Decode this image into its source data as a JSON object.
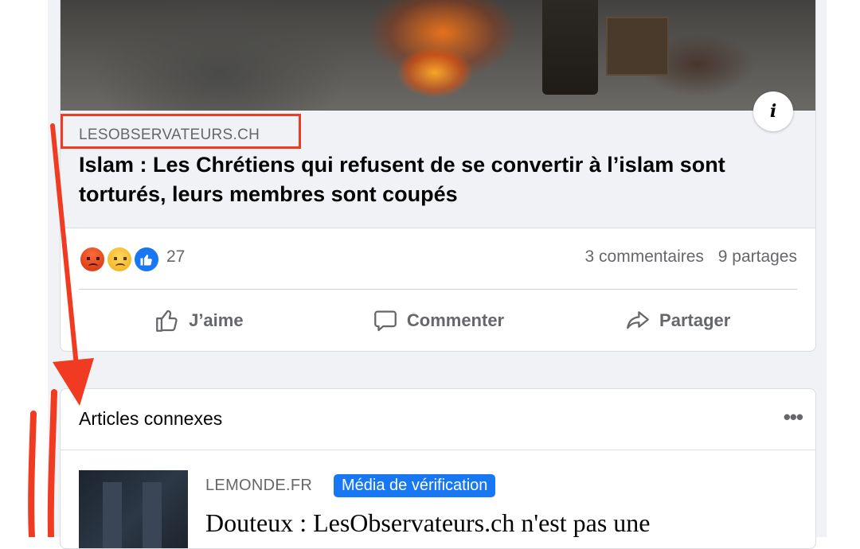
{
  "post": {
    "link_domain": "LESOBSERVATEURS.CH",
    "link_title": "Islam : Les Chrétiens qui refusent de se convertir à l’islam sont torturés, leurs membres sont coupés",
    "info_label": "i",
    "reaction_count": "27",
    "reactions": [
      "angry",
      "sad",
      "like"
    ],
    "comments_text": "3 commentaires",
    "shares_text": "9 partages",
    "actions": {
      "like": "J’aime",
      "comment": "Commenter",
      "share": "Partager"
    }
  },
  "related": {
    "header": "Articles connexes",
    "more_label": "•••",
    "items": [
      {
        "source": "LEMONDE.FR",
        "badge": "Média de vérification",
        "title": "Douteux : LesObservateurs.ch n'est pas une"
      }
    ]
  },
  "colors": {
    "accent": "#1877f2",
    "annotation": "#f03a21",
    "feed_background": "#f0f2f5"
  }
}
